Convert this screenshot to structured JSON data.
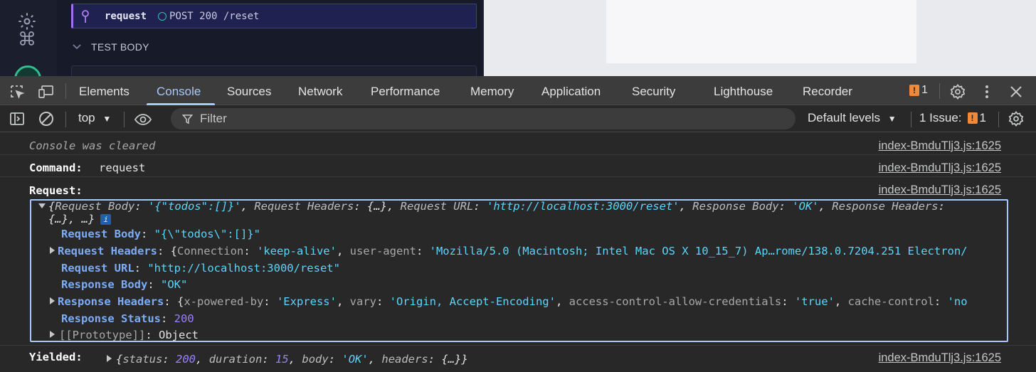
{
  "runner": {
    "command_name": "request",
    "command_message": "POST 200 /reset",
    "section_label": "TEST BODY"
  },
  "devtools": {
    "tabs": [
      "Elements",
      "Console",
      "Sources",
      "Network",
      "Performance",
      "Memory",
      "Application",
      "Security",
      "Lighthouse",
      "Recorder"
    ],
    "active_tab": "Console",
    "issue_count": "1",
    "context": "top",
    "filter_placeholder": "Filter",
    "levels": "Default levels",
    "issues_label": "1 Issue:",
    "issues_count": "1"
  },
  "console": {
    "source": "index-BmduTlj3.js:1625",
    "cleared": "Console was cleared",
    "command_label": "Command:",
    "command_value": "request",
    "request_label": "Request:",
    "yielded_label": "Yielded:",
    "summary_line1": {
      "k1": "Request Body",
      "v1": "'{\"todos\":[]}'",
      "k2": "Request Headers",
      "v2": "{…}",
      "k3": "Request URL",
      "v3": "'http://localhost:3000/reset'",
      "k4": "Response Body",
      "v4": "'OK'",
      "k5": "Response Headers"
    },
    "summary_line2": "{…}, …}",
    "info_badge": "i",
    "request_body_key": "Request Body",
    "request_body_val": "\"{\\\"todos\\\":[]}\"",
    "request_headers_key": "Request Headers",
    "rh_connection_key": "Connection",
    "rh_connection_val": "'keep-alive'",
    "rh_ua_key": "user-agent",
    "rh_ua_val": "'Mozilla/5.0 (Macintosh; Intel Mac OS X 10_15_7) Ap…rome/138.0.7204.251 Electron/",
    "request_url_key": "Request URL",
    "request_url_val": "\"http://localhost:3000/reset\"",
    "response_body_key": "Response Body",
    "response_body_val": "\"OK\"",
    "response_headers_key": "Response Headers",
    "xh_pb_key": "x-powered-by",
    "xh_pb_val": "'Express'",
    "xh_vary_key": "vary",
    "xh_vary_val": "'Origin, Accept-Encoding'",
    "xh_acac_key": "access-control-allow-credentials",
    "xh_acac_val": "'true'",
    "xh_cc_key": "cache-control",
    "xh_cc_val": "'no",
    "response_status_key": "Response Status",
    "response_status_val": "200",
    "prototype_key": "[[Prototype]]",
    "prototype_val": "Object",
    "yield_status_key": "status",
    "yield_status_val": "200",
    "yield_duration_key": "duration",
    "yield_duration_val": "15",
    "yield_body_key": "body",
    "yield_body_val": "'OK'",
    "yield_headers_key": "headers",
    "yield_headers_val": "{…}"
  }
}
